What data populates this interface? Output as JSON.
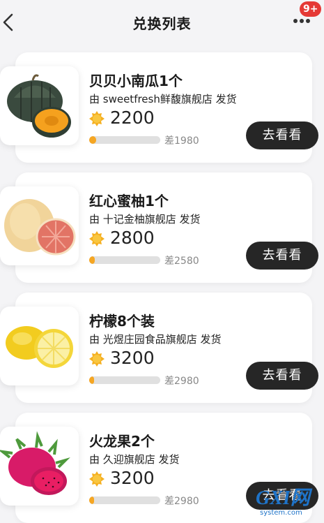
{
  "header": {
    "title": "兑换列表",
    "badge": "9+",
    "back_icon": "chevron-left-icon",
    "more_icon": "more-dots-icon"
  },
  "colors": {
    "accent": "#f5a623",
    "button": "#262626",
    "badge": "#e53935",
    "background": "#f4f4f6"
  },
  "items": [
    {
      "name": "贝贝小南瓜1个",
      "seller": "由 sweetfresh鲜馥旗舰店 发货",
      "price": "2200",
      "diff": "差1980",
      "progress": 0.1,
      "button": "去看看",
      "image": "pumpkin-image"
    },
    {
      "name": "红心蜜柚1个",
      "seller": "由 十记金柚旗舰店 发货",
      "price": "2800",
      "diff": "差2580",
      "progress": 0.08,
      "button": "去看看",
      "image": "pomelo-image"
    },
    {
      "name": "柠檬8个装",
      "seller": "由 光煜庄园食品旗舰店 发货",
      "price": "3200",
      "diff": "差2980",
      "progress": 0.07,
      "button": "去看看",
      "image": "lemon-image"
    },
    {
      "name": "火龙果2个",
      "seller": "由 久迎旗舰店 发货",
      "price": "3200",
      "diff": "差2980",
      "progress": 0.07,
      "button": "去看看",
      "image": "dragon-fruit-image"
    }
  ],
  "watermark": {
    "brand": "GXI网",
    "site": "system.com"
  }
}
